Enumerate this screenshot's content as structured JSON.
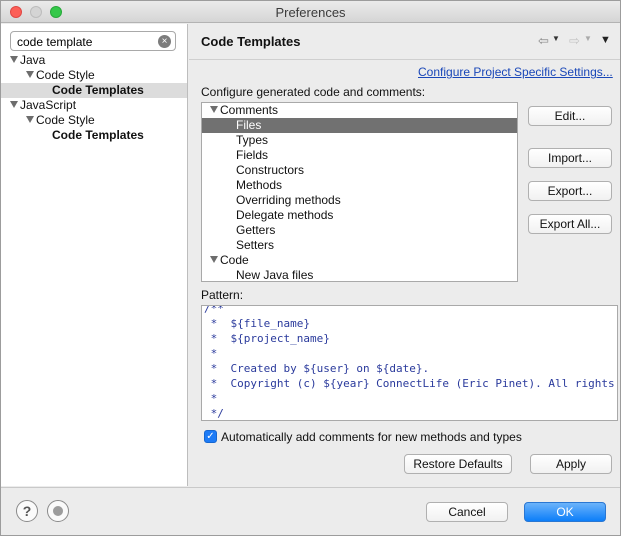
{
  "window": {
    "title": "Preferences"
  },
  "filter": {
    "value": "code template"
  },
  "left_tree": [
    {
      "label": "Java",
      "indent": 0,
      "expanded": true,
      "bold": false,
      "selected": false
    },
    {
      "label": "Code Style",
      "indent": 1,
      "expanded": true,
      "bold": false,
      "selected": false
    },
    {
      "label": "Code Templates",
      "indent": 2,
      "expanded": false,
      "bold": true,
      "selected": true
    },
    {
      "label": "JavaScript",
      "indent": 0,
      "expanded": true,
      "bold": false,
      "selected": false
    },
    {
      "label": "Code Style",
      "indent": 1,
      "expanded": true,
      "bold": false,
      "selected": false
    },
    {
      "label": "Code Templates",
      "indent": 2,
      "expanded": false,
      "bold": true,
      "selected": false
    }
  ],
  "page": {
    "title": "Code Templates",
    "config_link": "Configure Project Specific Settings...",
    "configure_label": "Configure generated code and comments:",
    "pattern_label": "Pattern:",
    "auto_comments_label": "Automatically add comments for new methods and types",
    "auto_comments_checked": true
  },
  "template_tree": [
    {
      "label": "Comments",
      "group": true,
      "selected": false
    },
    {
      "label": "Files",
      "group": false,
      "selected": true
    },
    {
      "label": "Types",
      "group": false,
      "selected": false
    },
    {
      "label": "Fields",
      "group": false,
      "selected": false
    },
    {
      "label": "Constructors",
      "group": false,
      "selected": false
    },
    {
      "label": "Methods",
      "group": false,
      "selected": false
    },
    {
      "label": "Overriding methods",
      "group": false,
      "selected": false
    },
    {
      "label": "Delegate methods",
      "group": false,
      "selected": false
    },
    {
      "label": "Getters",
      "group": false,
      "selected": false
    },
    {
      "label": "Setters",
      "group": false,
      "selected": false
    },
    {
      "label": "Code",
      "group": true,
      "selected": false
    },
    {
      "label": "New Java files",
      "group": false,
      "selected": false
    }
  ],
  "buttons": {
    "edit": "Edit...",
    "import": "Import...",
    "export": "Export...",
    "export_all": "Export All...",
    "restore_defaults": "Restore Defaults",
    "apply": "Apply",
    "cancel": "Cancel",
    "ok": "OK"
  },
  "pattern_lines": [
    "/**",
    " *  ${file_name}",
    " *  ${project_name}",
    " *",
    " *  Created by ${user} on ${date}.",
    " *  Copyright (c) ${year} ConnectLife (Eric Pinet). All rights reserved.",
    " *",
    " */"
  ],
  "icons": {
    "back": "⇦",
    "forward": "⇨",
    "menu": "▼",
    "help": "?",
    "check": "✓",
    "clear": "×"
  },
  "colors": {
    "selection": "#717171",
    "link": "#1a47b8",
    "primary": "#0c7ef9",
    "pattern_text": "#2a3a9c"
  }
}
